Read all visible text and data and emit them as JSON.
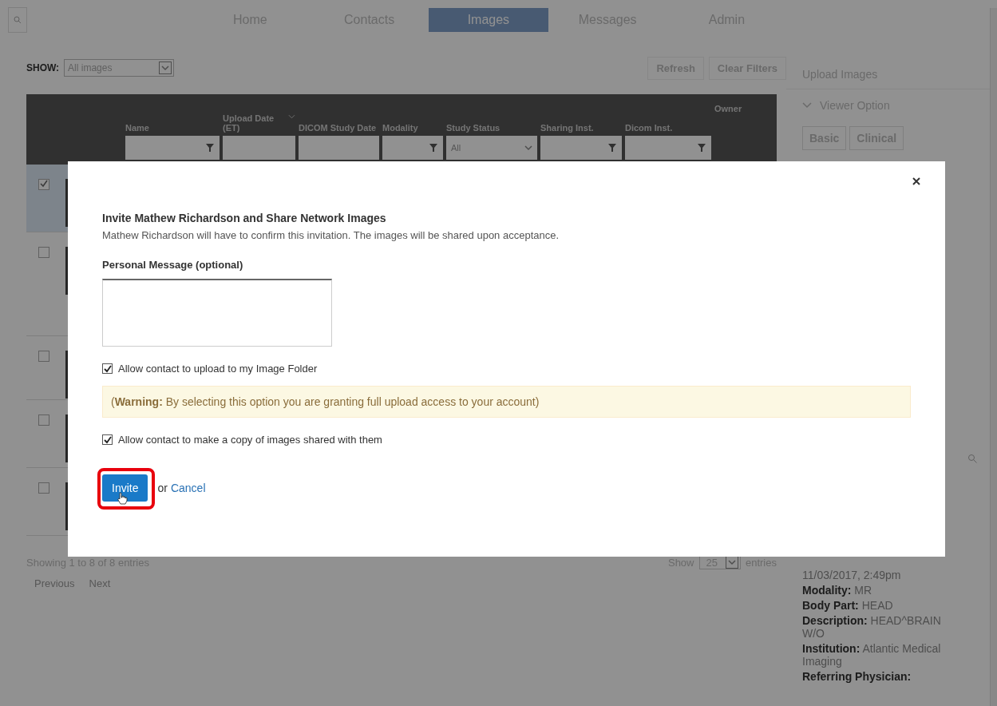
{
  "nav": {
    "tabs": [
      {
        "label": "Home",
        "selected": false
      },
      {
        "label": "Contacts",
        "selected": false
      },
      {
        "label": "Images",
        "selected": true
      },
      {
        "label": "Messages",
        "selected": false
      },
      {
        "label": "Admin",
        "selected": false
      }
    ]
  },
  "toolbar": {
    "show_label": "SHOW:",
    "show_value": "All images",
    "buttons": [
      "Refresh",
      "Clear Filters"
    ]
  },
  "table": {
    "columns": [
      {
        "label": "Name",
        "kind": "filter",
        "sorted": false
      },
      {
        "label": "Upload Date (ET)",
        "kind": "input",
        "sorted": true
      },
      {
        "label": "DICOM Study Date",
        "kind": "input",
        "sorted": false
      },
      {
        "label": "Modality",
        "kind": "filter",
        "sorted": false
      },
      {
        "label": "Study Status",
        "kind": "select",
        "value": "All",
        "sorted": false
      },
      {
        "label": "Sharing Inst.",
        "kind": "filter",
        "sorted": false
      },
      {
        "label": "Dicom Inst.",
        "kind": "filter",
        "sorted": false
      },
      {
        "label": "Owner",
        "kind": "none",
        "sorted": false
      }
    ],
    "rows": [
      {
        "checked": true,
        "selected": true
      },
      {
        "checked": false,
        "selected": false
      },
      {
        "checked": false,
        "selected": false
      },
      {
        "checked": false,
        "selected": false
      },
      {
        "checked": false,
        "selected": false
      }
    ]
  },
  "footer": {
    "info": "Showing 1 to 8 of 8 entries",
    "pages": [
      "Previous",
      "Next"
    ],
    "show": "Show",
    "page_size": "25",
    "entries": "entries"
  },
  "sidebar": {
    "upload": "Upload Images",
    "viewer_option": {
      "label": "Viewer Option",
      "expanded": true
    },
    "tabs": [
      {
        "label": "Basic",
        "selected": false
      },
      {
        "label": "Clinical",
        "selected": false
      }
    ],
    "details": [
      "11/03/2017, 2:49pm",
      "**Modality:** MR",
      "**Body Part:** HEAD",
      "**Description:** HEAD^BRAIN W/O",
      "**Institution:** Atlantic Medical Imaging",
      "**Referring Physician:**"
    ]
  },
  "dialog": {
    "title": "Invite Mathew Richardson and Share Network Images",
    "subtitle": "Mathew Richardson will have to confirm this invitation. The images will be shared upon acceptance.",
    "message_label": "Personal Message (optional)",
    "options": [
      {
        "label": "Allow contact to upload to my Image Folder",
        "checked": true,
        "warning": "(**Warning:** By selecting this option you are granting full upload access to your account)"
      },
      {
        "label": "Allow contact to make a copy of images shared with them",
        "checked": true
      }
    ],
    "submit": "Invite",
    "or": "or",
    "cancel": "Cancel",
    "highlighted": true
  }
}
